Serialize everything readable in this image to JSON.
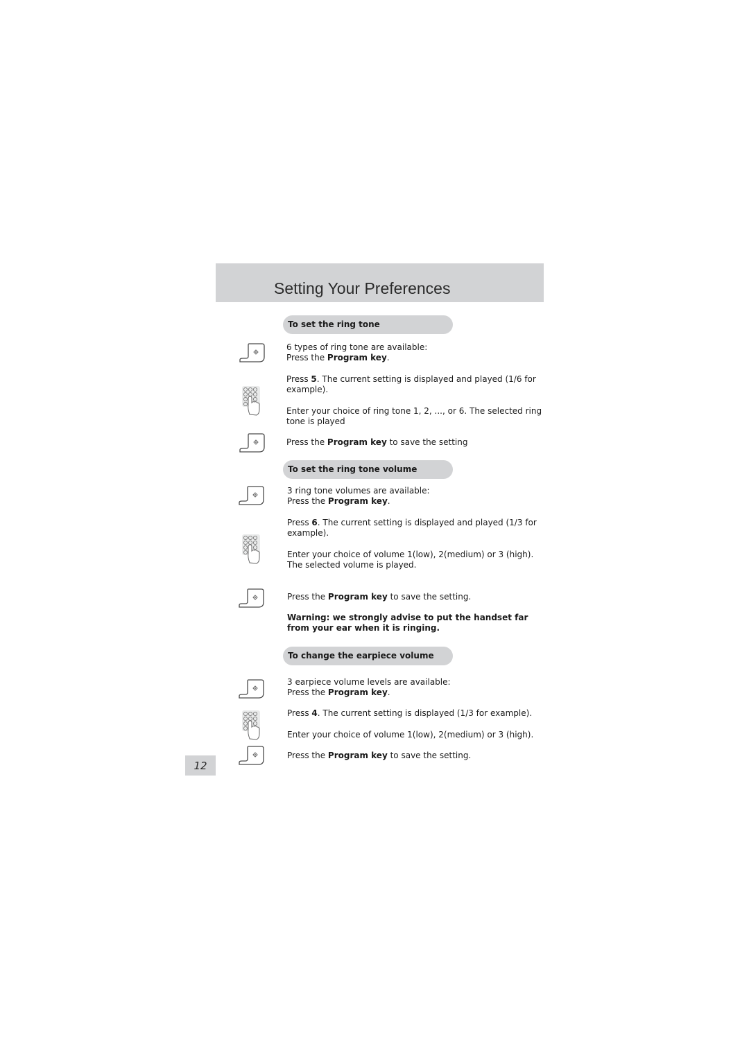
{
  "header": {
    "title": "Setting Your Preferences"
  },
  "sections": [
    {
      "heading": "To set the ring tone",
      "steps": [
        {
          "icon": "program-key-icon",
          "pre": "6 types of ring tone are available:\nPress the ",
          "bold": "Program key",
          "post": "."
        },
        {
          "icon": "keypad-icon",
          "pre": "Press ",
          "bold": "5",
          "post": ". The current setting is displayed and played (1/6 for example)."
        },
        {
          "icon": "",
          "pre": "Enter your choice of ring tone 1, 2, ..., or 6. The selected ring tone is played",
          "bold": "",
          "post": ""
        },
        {
          "icon": "program-key-icon",
          "pre": "Press the ",
          "bold": "Program key",
          "post": " to save the setting"
        }
      ]
    },
    {
      "heading": "To set the ring tone volume",
      "steps": [
        {
          "icon": "program-key-icon",
          "pre": "3 ring tone volumes are available:\nPress the ",
          "bold": "Program key",
          "post": "."
        },
        {
          "icon": "keypad-icon",
          "pre": "Press ",
          "bold": "6",
          "post": ". The current setting is displayed and played (1/3 for example)."
        },
        {
          "icon": "",
          "pre": "Enter your choice of volume 1(low), 2(medium) or 3 (high). The selected volume is played.",
          "bold": "",
          "post": ""
        },
        {
          "icon": "program-key-icon",
          "pre": "Press the ",
          "bold": "Program key",
          "post": " to save the setting."
        }
      ],
      "warning": "Warning: we strongly advise to put the handset far from your ear when it is ringing."
    },
    {
      "heading": "To change the earpiece volume",
      "steps": [
        {
          "icon": "program-key-icon",
          "pre": "3 earpiece volume levels are available:\nPress the ",
          "bold": "Program key",
          "post": "."
        },
        {
          "icon": "keypad-icon",
          "pre": "Press ",
          "bold": "4",
          "post": ". The current setting is displayed (1/3 for example)."
        },
        {
          "icon": "",
          "pre": "Enter your choice of volume 1(low), 2(medium) or 3 (high).",
          "bold": "",
          "post": ""
        },
        {
          "icon": "program-key-icon",
          "pre": "Press the ",
          "bold": "Program key",
          "post": " to save the setting."
        }
      ]
    }
  ],
  "page_number": "12"
}
